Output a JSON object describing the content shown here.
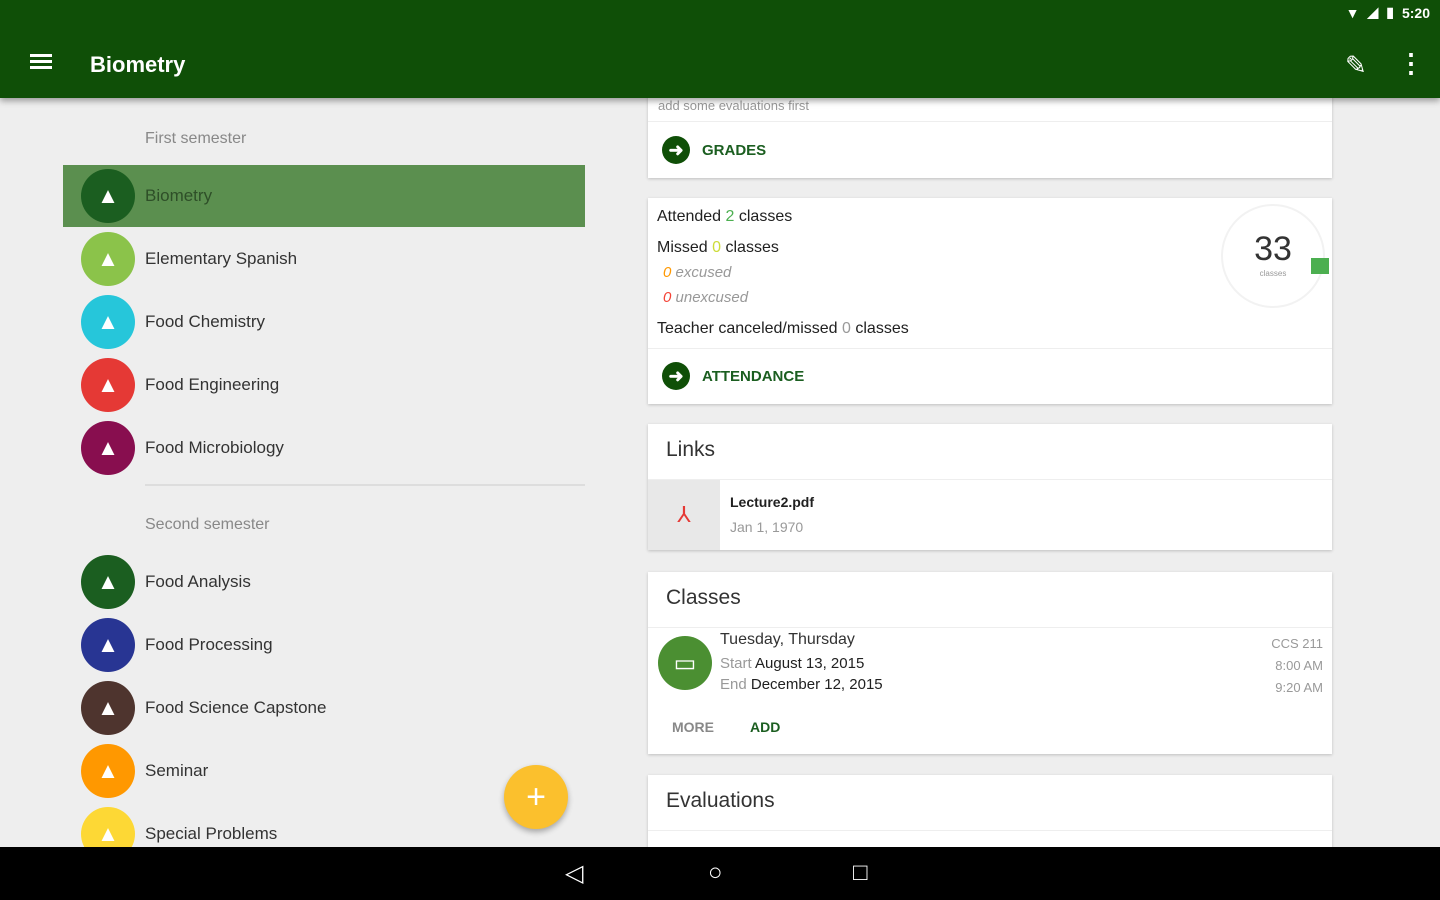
{
  "status": {
    "time": "5:20"
  },
  "appbar": {
    "title": "Biometry"
  },
  "sidebar": {
    "first_header": "First semester",
    "first": [
      {
        "label": "Biometry",
        "color": "#1b5e20"
      },
      {
        "label": "Elementary Spanish",
        "color": "#8bc34a"
      },
      {
        "label": "Food Chemistry",
        "color": "#26c6da"
      },
      {
        "label": "Food Engineering",
        "color": "#e53935"
      },
      {
        "label": "Food Microbiology",
        "color": "#880e4f"
      }
    ],
    "second_header": "Second semester",
    "second": [
      {
        "label": "Food Analysis",
        "color": "#1b5e20"
      },
      {
        "label": "Food Processing",
        "color": "#283593"
      },
      {
        "label": "Food Science Capstone",
        "color": "#4e342e"
      },
      {
        "label": "Seminar",
        "color": "#ff9800"
      },
      {
        "label": "Special Problems",
        "color": "#fdd835"
      }
    ]
  },
  "grades": {
    "hint": "add some evaluations first",
    "action": "GRADES"
  },
  "attendance": {
    "attended_prefix": "Attended",
    "attended": "2",
    "classes_word": "classes",
    "missed_prefix": "Missed",
    "missed": "0",
    "excused": "0",
    "excused_label": "excused",
    "unexcused": "0",
    "unexcused_label": "unexcused",
    "teacher_text": "Teacher canceled/missed",
    "teacher": "0",
    "total": "33",
    "total_label": "classes",
    "action": "ATTENDANCE"
  },
  "links": {
    "title": "Links",
    "items": [
      {
        "name": "Lecture2.pdf",
        "date": "Jan 1, 1970"
      }
    ]
  },
  "classes": {
    "title": "Classes",
    "days": "Tuesday, Thursday",
    "start_label": "Start",
    "start": "August 13, 2015",
    "end_label": "End",
    "end": "December 12, 2015",
    "room": "CCS 211",
    "time_start": "8:00 AM",
    "time_end": "9:20 AM",
    "more": "MORE",
    "add": "ADD"
  },
  "evaluations": {
    "title": "Evaluations"
  }
}
